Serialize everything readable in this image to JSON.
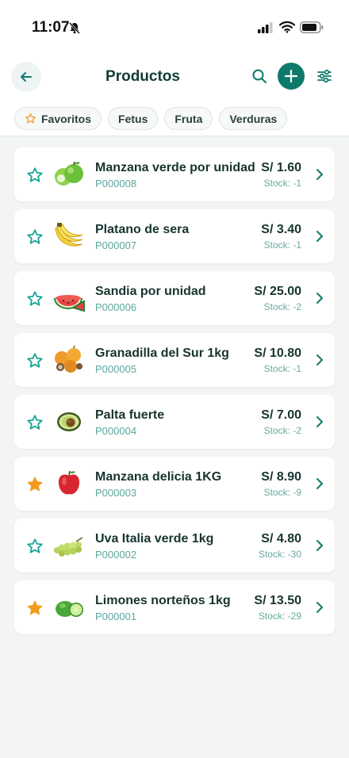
{
  "status": {
    "time": "11:07"
  },
  "header": {
    "title": "Productos"
  },
  "chips": [
    {
      "label": "Favoritos",
      "icon": "star-outline-icon"
    },
    {
      "label": "Fetus"
    },
    {
      "label": "Fruta"
    },
    {
      "label": "Verduras"
    }
  ],
  "products": [
    {
      "name": "Manzana verde por unidad",
      "code": "P000008",
      "price": "S/ 1.60",
      "stock": "Stock: -1",
      "favorite": false,
      "image": "green-apple"
    },
    {
      "name": "Platano de sera",
      "code": "P000007",
      "price": "S/ 3.40",
      "stock": "Stock: -1",
      "favorite": false,
      "image": "banana"
    },
    {
      "name": "Sandia por unidad",
      "code": "P000006",
      "price": "S/ 25.00",
      "stock": "Stock: -2",
      "favorite": false,
      "image": "watermelon"
    },
    {
      "name": "Granadilla del Sur 1kg",
      "code": "P000005",
      "price": "S/ 10.80",
      "stock": "Stock: -1",
      "favorite": false,
      "image": "granadilla"
    },
    {
      "name": "Palta fuerte",
      "code": "P000004",
      "price": "S/ 7.00",
      "stock": "Stock: -2",
      "favorite": false,
      "image": "avocado"
    },
    {
      "name": "Manzana delicia 1KG",
      "code": "P000003",
      "price": "S/ 8.90",
      "stock": "Stock: -9",
      "favorite": true,
      "image": "red-apple"
    },
    {
      "name": "Uva Italia verde 1kg",
      "code": "P000002",
      "price": "S/ 4.80",
      "stock": "Stock: -30",
      "favorite": false,
      "image": "grapes"
    },
    {
      "name": "Limones norteños 1kg",
      "code": "P000001",
      "price": "S/ 13.50",
      "stock": "Stock: -29",
      "favorite": true,
      "image": "limes"
    }
  ],
  "colors": {
    "accent": "#0f7a6c",
    "star_outline": "#1aa594",
    "star_filled": "#f29b1d"
  }
}
